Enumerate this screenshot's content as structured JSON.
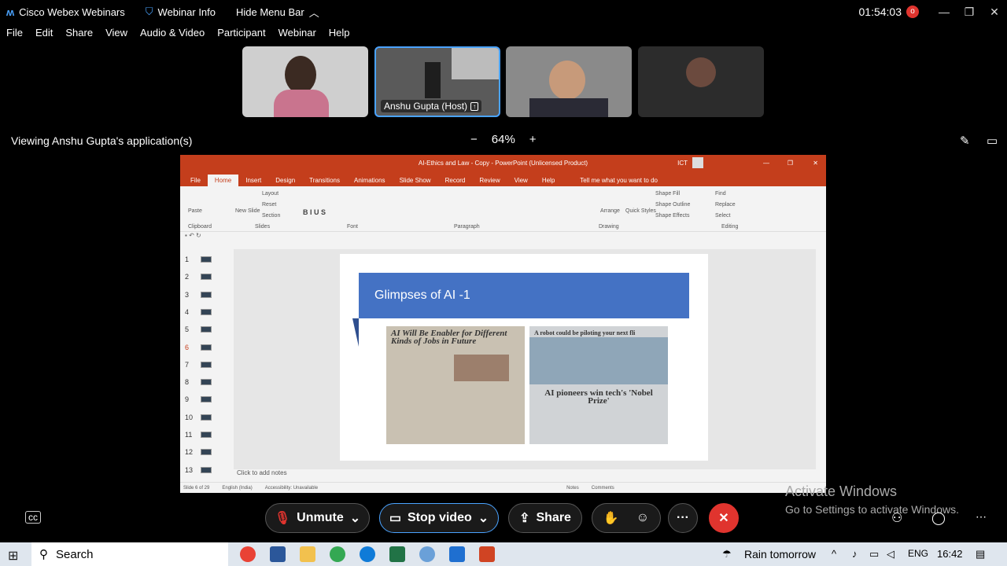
{
  "titlebar": {
    "app_name": "Cisco Webex Webinars",
    "webinar_info": "Webinar Info",
    "hide_menu": "Hide Menu Bar",
    "timer": "01:54:03",
    "rec_indicator": "o"
  },
  "menu": [
    "File",
    "Edit",
    "Share",
    "View",
    "Audio & Video",
    "Participant",
    "Webinar",
    "Help"
  ],
  "participants": [
    {
      "name": ""
    },
    {
      "name": "Anshu Gupta (Host)"
    },
    {
      "name": ""
    },
    {
      "name": ""
    }
  ],
  "viewing_text": "Viewing Anshu Gupta's application(s)",
  "zoom": {
    "minus": "−",
    "value": "64%",
    "plus": "+"
  },
  "ppt": {
    "title": "AI-Ethics and Law - Copy  -  PowerPoint (Unlicensed Product)",
    "account": "ICT",
    "tabs": [
      "File",
      "Home",
      "Insert",
      "Design",
      "Transitions",
      "Animations",
      "Slide Show",
      "Record",
      "Review",
      "View",
      "Help"
    ],
    "tell_me": "Tell me what you want to do",
    "groups": [
      "Clipboard",
      "Slides",
      "Font",
      "Paragraph",
      "Drawing",
      "Editing"
    ],
    "ribbon_labels": {
      "paste": "Paste",
      "new_slide": "New Slide",
      "layout": "Layout",
      "reset": "Reset",
      "section": "Section",
      "arrange": "Arrange",
      "quick_styles": "Quick Styles",
      "shape_fill": "Shape Fill",
      "shape_outline": "Shape Outline",
      "shape_effects": "Shape Effects",
      "find": "Find",
      "replace": "Replace",
      "select": "Select"
    },
    "slides": [
      "1",
      "2",
      "3",
      "4",
      "5",
      "6",
      "7",
      "8",
      "9",
      "10",
      "11",
      "12",
      "13"
    ],
    "current_slide_index": 6,
    "slide_title": "Glimpses of AI -1",
    "clip1_headline": "AI Will Be Enabler for Different Kinds of Jobs in Future",
    "clip2_headline_top": "A robot could be piloting your next fli",
    "clip2_headline_mid": "AI pioneers win tech's 'Nobel Prize'",
    "notes_placeholder": "Click to add notes",
    "status": {
      "slide": "Slide 6 of 29",
      "language": "English (India)",
      "accessibility": "Accessibility: Unavailable",
      "notes": "Notes",
      "comments": "Comments"
    }
  },
  "activate": {
    "line1": "Activate Windows",
    "line2": "Go to Settings to activate Windows."
  },
  "controls": {
    "unmute": "Unmute",
    "stop_video": "Stop video",
    "share": "Share",
    "more": "···"
  },
  "taskbar": {
    "search": "Search",
    "weather": "Rain tomorrow",
    "lang": "ENG",
    "time": "16:42"
  },
  "colors": {
    "ppt_accent": "#c43e1c",
    "slide_banner": "#4472c4",
    "end_button": "#e0342e",
    "host_border": "#4aa3ff"
  }
}
